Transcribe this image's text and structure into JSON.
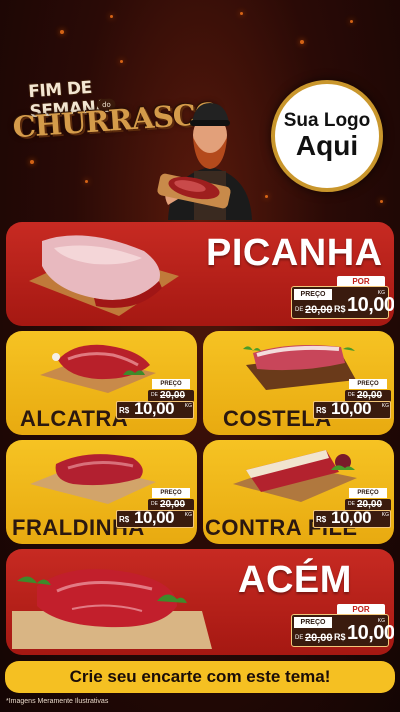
{
  "header": {
    "title_line1": "FIM DE SEMANA",
    "title_do": "do",
    "title_line2": "CHURRASCO",
    "logo_line1": "Sua Logo",
    "logo_line2": "Aqui"
  },
  "price_labels": {
    "por": "POR",
    "preco": "PREÇO",
    "de": "DE",
    "currency": "R$",
    "unit": "KG"
  },
  "products": [
    {
      "name": "PICANHA",
      "old_price": "20,00",
      "price": "10,00"
    },
    {
      "name": "ALCATRA",
      "old_price": "20,00",
      "price": "10,00"
    },
    {
      "name": "COSTELA",
      "old_price": "20,00",
      "price": "10,00"
    },
    {
      "name": "FRALDINHA",
      "old_price": "20,00",
      "price": "10,00"
    },
    {
      "name": "CONTRA FILÉ",
      "old_price": "20,00",
      "price": "10,00"
    },
    {
      "name": "ACÉM",
      "old_price": "20,00",
      "price": "10,00"
    }
  ],
  "cta": "Crie seu encarte com este tema!",
  "disclaimer": "*Imagens Meramente Ilustrativas",
  "colors": {
    "red": "#c72a22",
    "yellow": "#f6c323",
    "dark": "#3a1b0e",
    "gold": "#c9962c"
  }
}
